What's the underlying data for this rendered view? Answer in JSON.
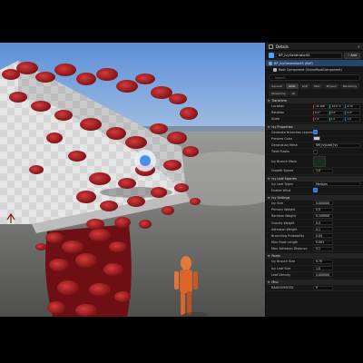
{
  "panel": {
    "tab_label": "Details",
    "close": "×",
    "actor_name": "BP_IvyGenerator45",
    "add_label": "Add",
    "comp_root": "BP_IvyGenerator45 (Self)",
    "comp_sub": "Root Component (SceneRootComponent)",
    "search_placeholder": "Search",
    "tabs": [
      "General",
      "Actor",
      "LOD",
      "Misc",
      "Physics",
      "Rendering",
      "Streaming",
      "All"
    ],
    "sections": {
      "transform": "Transform",
      "ivy_props": "Ivy Properties",
      "ivy_species": "Ivy Leaf Species",
      "ivy_settings": "Ivy Settings",
      "roots": "Roots",
      "misc": "Misc"
    },
    "transform": {
      "location": "Location",
      "rotation": "Rotation",
      "scale": "Scale",
      "loc": [
        "-32.108",
        "-1017.3",
        "4.70"
      ],
      "rot": [
        "0.0°",
        "0.0°",
        "0.0°"
      ],
      "scl": [
        "1.0",
        "1.0",
        "1.0"
      ]
    },
    "ivy_props": [
      {
        "label": "Generate Branches Leaves Mesh",
        "type": "check",
        "on": true
      },
      {
        "label": "Preview Color",
        "type": "color"
      },
      {
        "label": "Generation Mesh",
        "type": "value",
        "value": "SM_IvyLeaf_Ivy"
      },
      {
        "label": "Treat Flasks",
        "type": "check",
        "on": false
      },
      {
        "label": "Ivy Branch Mesh",
        "type": "thumb"
      },
      {
        "label": "Growth Speed",
        "type": "value",
        "value": "1.0"
      }
    ],
    "ivy_species": [
      {
        "label": "Ivy Leaf Types",
        "value": "Medium"
      },
      {
        "label": "Enable Wind",
        "type": "check",
        "on": true
      }
    ],
    "ivy_settings": [
      {
        "label": "Ivy Size",
        "value": "0.000000"
      },
      {
        "label": "Primary Weight",
        "value": "0.5"
      },
      {
        "label": "Random Weight",
        "value": "0.100000"
      },
      {
        "label": "Gravity Weight",
        "value": "0.0"
      },
      {
        "label": "Adhesion Weight",
        "value": "0.1"
      },
      {
        "label": "Branching Probability",
        "value": "0.05"
      },
      {
        "label": "Max Float Length",
        "value": "0.001"
      },
      {
        "label": "Max Adhesion Distance",
        "value": "0.1"
      }
    ],
    "roots": [
      {
        "label": "Ivy Branch Size",
        "value": "0.70"
      },
      {
        "label": "Ivy Leaf Size",
        "value": "1.0"
      },
      {
        "label": "Leaf Density",
        "value": "0.000000"
      }
    ],
    "misc": [
      {
        "label": "RANDOMSEED",
        "value": "0"
      }
    ]
  }
}
